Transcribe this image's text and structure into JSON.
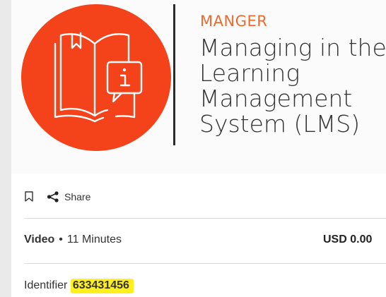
{
  "banner": {
    "brand": "MANGER",
    "title": "Managing in the\nLearning\nManagement\nSystem (LMS)",
    "logo_icon": "open-book-info-icon",
    "colors": {
      "logo_background": "#f4421b",
      "brand_text": "#f06a2e",
      "divider": "#2b2b2b"
    }
  },
  "actions": {
    "bookmark_icon": "bookmark-icon",
    "share_icon": "share-icon",
    "share_label": "Share"
  },
  "details": {
    "type": "Video",
    "separator": "•",
    "duration": "11 Minutes",
    "price": "USD 0.00"
  },
  "identifier": {
    "label": "Identifier",
    "value": "633431456",
    "highlight_color": "#ffef1c"
  }
}
